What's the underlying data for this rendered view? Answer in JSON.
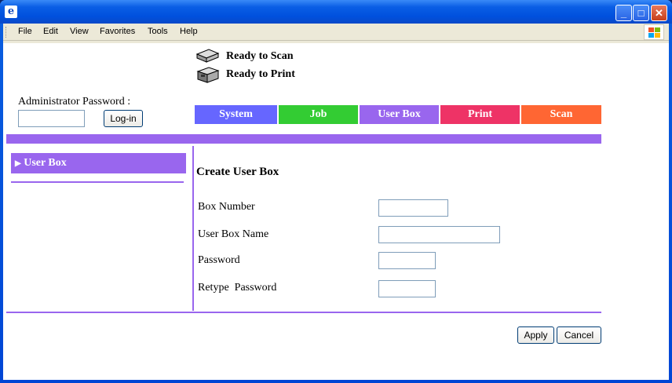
{
  "menu": [
    "File",
    "Edit",
    "View",
    "Favorites",
    "Tools",
    "Help"
  ],
  "status": {
    "scan": "Ready to Scan",
    "print": "Ready to Print"
  },
  "admin": {
    "label": "Administrator Password :",
    "login_label": "Log-in"
  },
  "tabs": [
    {
      "label": "System",
      "color": "#6666ff"
    },
    {
      "label": "Job",
      "color": "#33cc33"
    },
    {
      "label": "User Box",
      "color": "#9966ee"
    },
    {
      "label": "Print",
      "color": "#ee3366"
    },
    {
      "label": "Scan",
      "color": "#ff6633"
    }
  ],
  "sidebar": {
    "items": [
      {
        "label": "User Box"
      }
    ]
  },
  "form": {
    "title": "Create User Box",
    "fields": [
      {
        "label": "Box Number",
        "value": ""
      },
      {
        "label": "User Box Name",
        "value": ""
      },
      {
        "label": "Password",
        "value": ""
      },
      {
        "label": "Retype  Password",
        "value": ""
      }
    ]
  },
  "actions": {
    "apply": "Apply",
    "cancel": "Cancel"
  },
  "colors": {
    "accent": "#9966ee"
  }
}
